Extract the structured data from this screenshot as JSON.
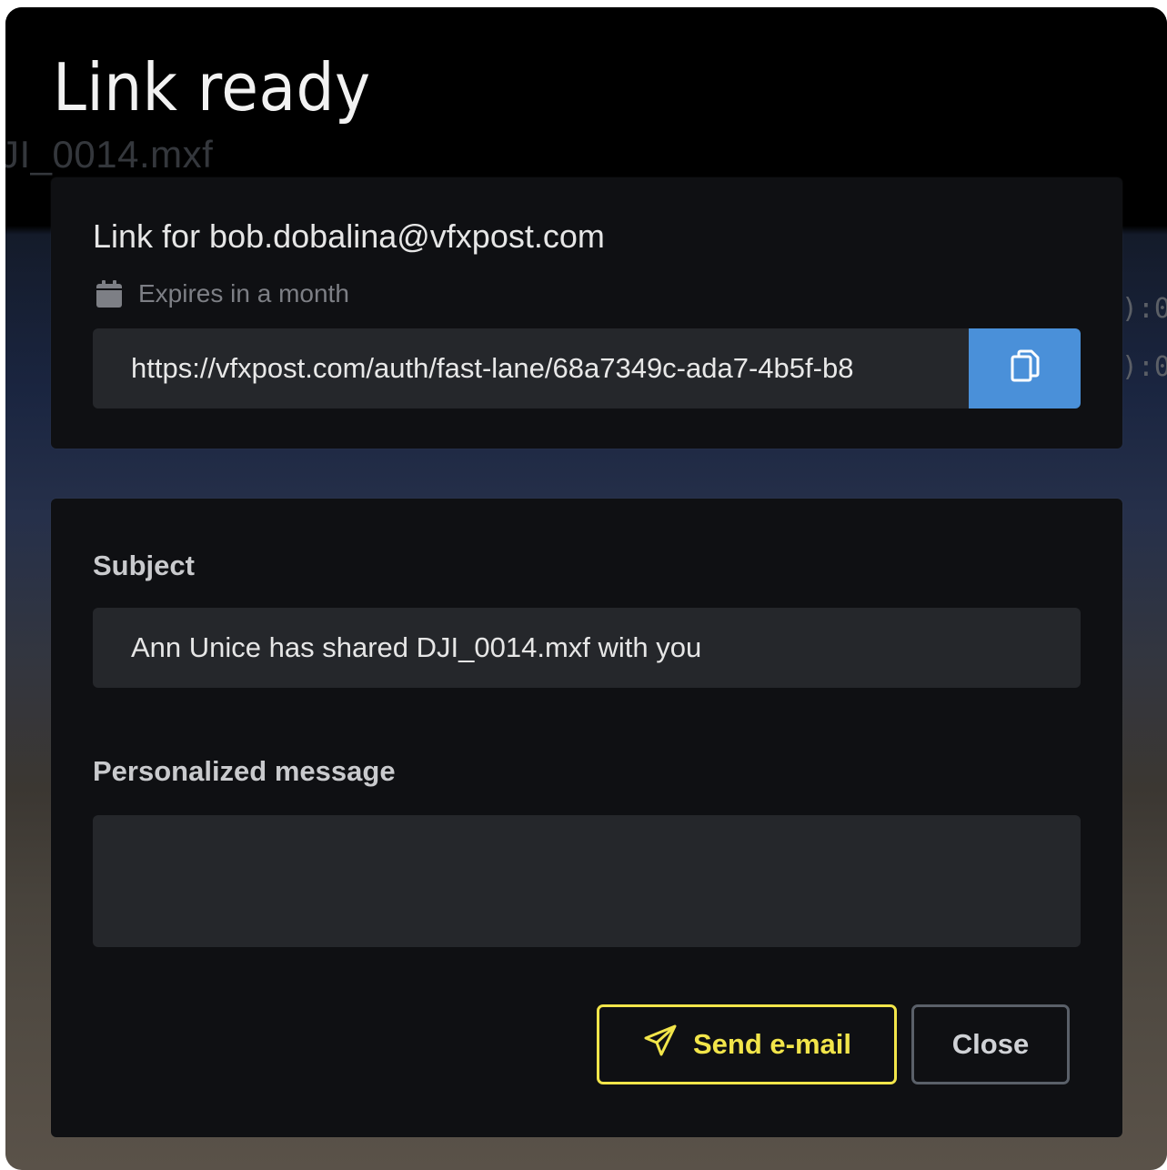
{
  "modal": {
    "title": "Link ready"
  },
  "background": {
    "filename": "JI_0014.mxf",
    "timecode_1": "):0",
    "timecode_2": "):0"
  },
  "link_card": {
    "recipient_label": "Link for bob.dobalina@vfxpost.com",
    "expires_text": "Expires in a month",
    "expires_icon": "calendar-icon",
    "url": "https://vfxpost.com/auth/fast-lane/68a7349c-ada7-4b5f-b8",
    "copy_icon": "copy-icon",
    "copy_button_color": "#4a90d9"
  },
  "email_card": {
    "subject_label": "Subject",
    "subject_value": "Ann Unice has shared DJI_0014.mxf with you",
    "message_label": "Personalized message",
    "message_value": "",
    "send_label": "Send e-mail",
    "send_icon": "paper-plane-icon",
    "send_color": "#f2e54a",
    "close_label": "Close"
  }
}
